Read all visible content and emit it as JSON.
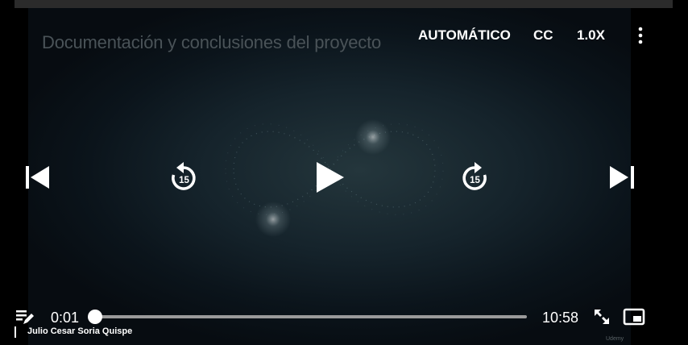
{
  "player": {
    "title": "Documentación y conclusiones del proyecto",
    "quality_label": "AUTOMÁTICO",
    "captions_label": "CC",
    "speed_label": "1.0X",
    "rewind_seconds": "15",
    "forward_seconds": "15",
    "current_time": "0:01",
    "duration": "10:58",
    "progress_fraction": 0.0015,
    "user_name": "Julio Cesar Soria Quispe",
    "watermark": "Udemy"
  },
  "icons": {
    "more": "more-vertical-icon",
    "prev": "skip-previous-icon",
    "rewind": "replay-15-icon",
    "play": "play-icon",
    "forward": "forward-15-icon",
    "next": "skip-next-icon",
    "notes": "edit-note-icon",
    "expand": "expand-icon",
    "pip": "picture-in-picture-icon"
  }
}
